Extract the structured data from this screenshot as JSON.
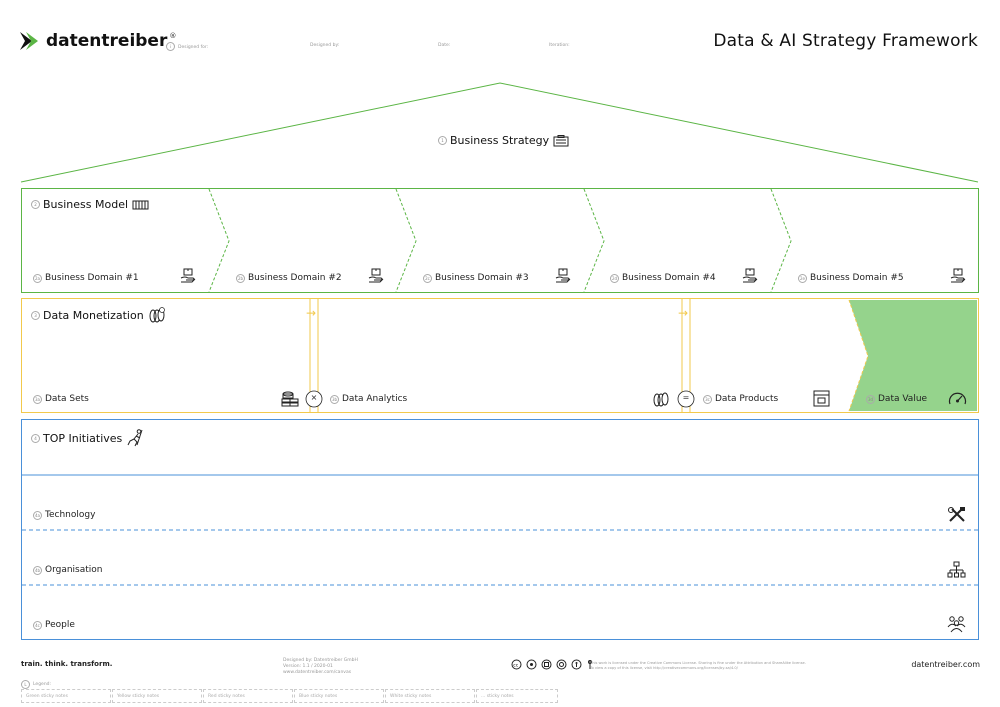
{
  "header": {
    "brand": "datentreiber",
    "brand_mark": "®",
    "fields": [
      "Designed for:",
      "Designed by:",
      "Date:",
      "Iteration:"
    ],
    "title": "Data & AI Strategy Framework"
  },
  "strategy": {
    "num": "1",
    "label": "Business Strategy",
    "icon": "briefcase-icon"
  },
  "business_model": {
    "num": "2",
    "label": "Business Model",
    "icon": "chip-icon",
    "domains": [
      {
        "num": "2a",
        "label": "Business Domain #1"
      },
      {
        "num": "2b",
        "label": "Business Domain #2"
      },
      {
        "num": "2c",
        "label": "Business Domain #3"
      },
      {
        "num": "2d",
        "label": "Business Domain #4"
      },
      {
        "num": "2e",
        "label": "Business Domain #5"
      }
    ]
  },
  "data_monetization": {
    "num": "3",
    "label": "Data Monetization",
    "icon": "coins-icon",
    "items": [
      {
        "num": "3a",
        "label": "Data Sets"
      },
      {
        "num": "3b",
        "label": "Data Analytics"
      },
      {
        "num": "3c",
        "label": "Data Products"
      },
      {
        "num": "3d",
        "label": "Data Value"
      }
    ],
    "operators": [
      "×",
      "="
    ],
    "arrows": [
      "→",
      "→"
    ]
  },
  "top_initiatives": {
    "num": "4",
    "label": "TOP Initiatives",
    "icon": "runner-icon",
    "rows": [
      {
        "num": "4a",
        "label": "Technology"
      },
      {
        "num": "4b",
        "label": "Organisation"
      },
      {
        "num": "4c",
        "label": "People"
      }
    ]
  },
  "footer": {
    "slogan": "train. think. transform.",
    "credit_lines": [
      "Designed by: Datentreiber GmbH",
      "Version: 1.1 / 2020-01",
      "www.datentreiber.com/canvas"
    ],
    "license": "This work is licensed under the Creative Commons License. Sharing is fine under the Attribution and ShareAlike license.",
    "license2": "To view a copy of this license, visit http://creativecommons.org/licenses/by-sa/4.0/",
    "site": "datentreiber.com",
    "legend_num": "L",
    "legend_label": "Legend:",
    "stickies": [
      "Green sticky notes",
      "Yellow sticky notes",
      "Red sticky notes",
      "Blue sticky notes",
      "White sticky notes",
      "... sticky notes"
    ]
  },
  "colors": {
    "green": "#5bb545",
    "green_fill": "#95d38c",
    "yellow": "#f2c94c",
    "blue": "#4a90d9"
  }
}
